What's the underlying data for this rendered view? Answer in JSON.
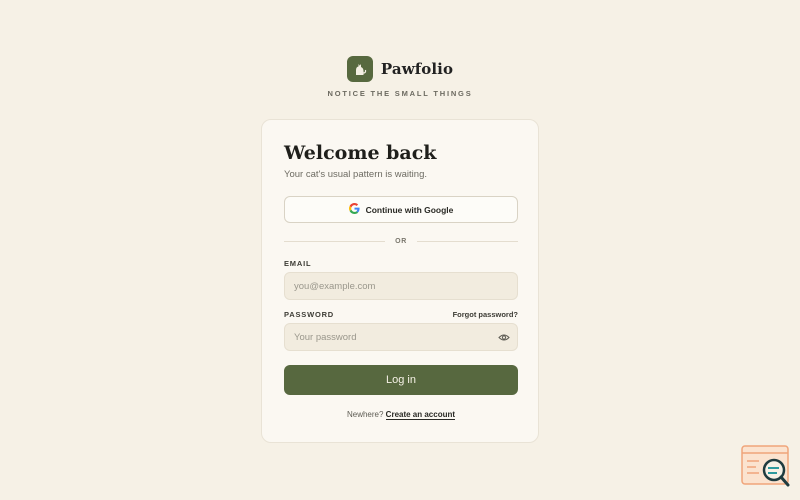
{
  "brand": {
    "name": "Pawfolio",
    "tagline": "NOTICE THE SMALL THINGS",
    "logo_icon": "cat-icon",
    "accent_color": "#57693f"
  },
  "login": {
    "title": "Welcome back",
    "subtitle": "Your cat's usual pattern is waiting.",
    "google_button": "Continue with Google",
    "divider_text": "OR",
    "email_label": "EMAIL",
    "email_placeholder": "you@example.com",
    "password_label": "PASSWORD",
    "forgot_password": "Forgot password?",
    "password_placeholder": "Your password",
    "submit_button": "Log in",
    "signup_prompt": "Newhere?",
    "signup_link": "Create an account"
  },
  "colors": {
    "background": "#f6f1e6",
    "card": "#fbf8f2",
    "primary_button": "#57683f"
  }
}
